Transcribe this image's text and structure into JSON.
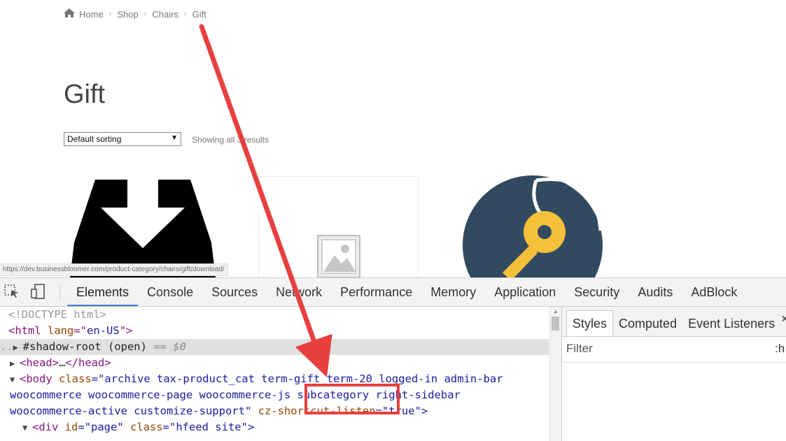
{
  "breadcrumb": {
    "items": [
      "Home",
      "Shop",
      "Chairs",
      "Gift"
    ],
    "separator": "›"
  },
  "page_title": "Gift",
  "sorting": {
    "selected": "Default sorting"
  },
  "result_count": "Showing all 3 results",
  "status_url": "https://dev.businessbloomer.com/product-category/chairs/gift/download/",
  "devtools": {
    "tabs": [
      "Elements",
      "Console",
      "Sources",
      "Network",
      "Performance",
      "Memory",
      "Application",
      "Security",
      "Audits",
      "AdBlock"
    ],
    "active_tab": "Elements",
    "dom": {
      "l1": "<!DOCTYPE html>",
      "l2_tag": "<html",
      "l2_attr": " lang",
      "l2_eq": "=\"",
      "l2_val": "en-US",
      "l2_end": "\">",
      "l3_prefix": "..",
      "l3_text": "#shadow-root (open)",
      "l3_eq": " == $0",
      "l4_tag": "<head>",
      "l4_dots": "…",
      "l4_end": "</head>",
      "l5_tag": "<body",
      "l5_attr": " class",
      "l5_val": "=\"archive tax-product_cat term-gift term-20 logged-in admin-bar",
      "l6_val": "woocommerce woocommerce-page woocommerce-js subcategory right-sidebar",
      "l7_val": "woocommerce-active customize-support\"",
      "l7_attr": " cz-shortcut-listen",
      "l7_val2": "=\"true\">",
      "l8_tag": "<div",
      "l8_attr": " id",
      "l8_val": "=\"page\"",
      "l8_attr2": " class",
      "l8_val2": "=\"hfeed site\">"
    },
    "sidebar": {
      "tabs": [
        "Styles",
        "Computed",
        "Event Listeners"
      ],
      "active": "Styles",
      "filter_placeholder": "Filter",
      "hov": ":h"
    },
    "close_label": "×"
  },
  "annotation": {
    "highlight_word": "subcategory",
    "color": "#e84040"
  },
  "colors": {
    "accent": "#3879d9",
    "arrow": "#e84040",
    "key_circle": "#324a5f",
    "key_yellow": "#f5c13b"
  }
}
